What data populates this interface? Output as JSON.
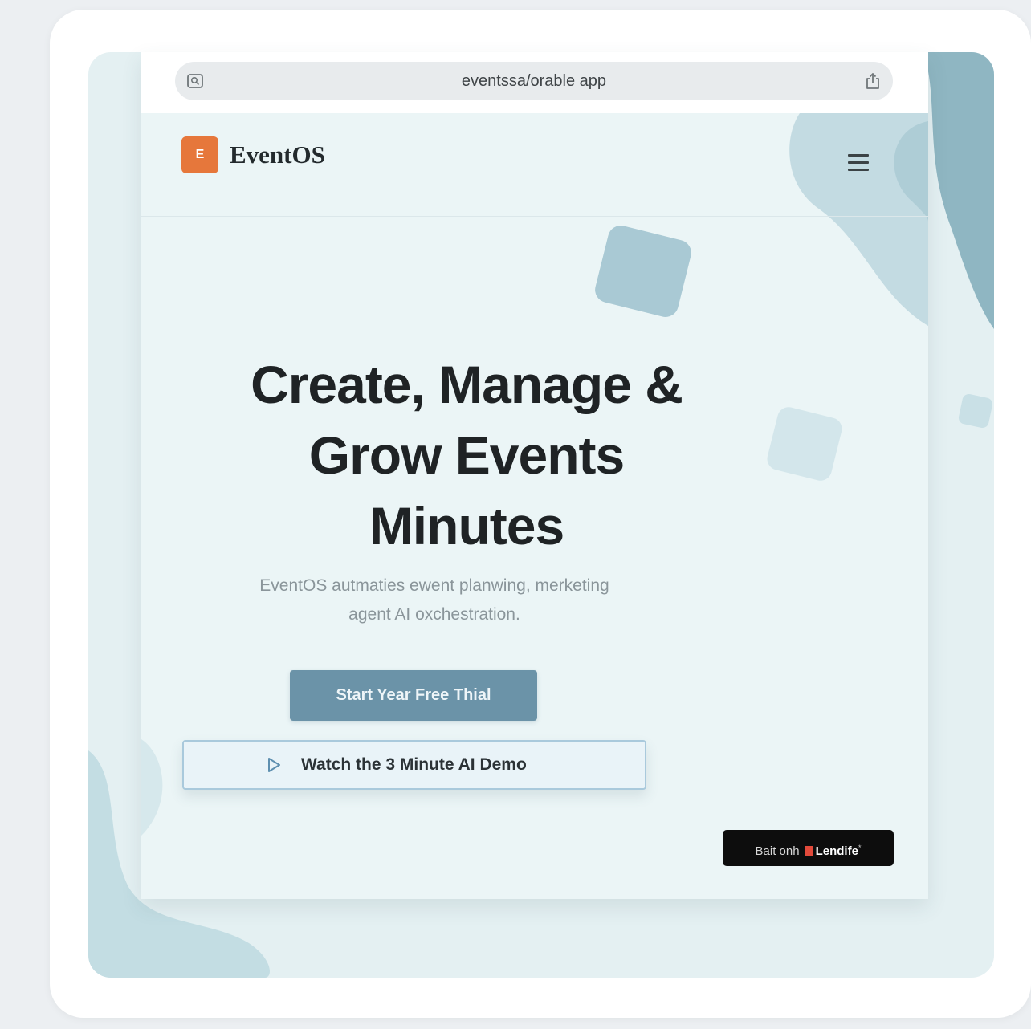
{
  "browser": {
    "url": "eventssa/orable app",
    "left_icon": "page-settings-icon",
    "right_icon": "share-icon"
  },
  "site": {
    "logo_letter": "E",
    "name": "EventOS",
    "menu_icon": "hamburger-menu-icon"
  },
  "hero": {
    "title_lines": [
      "Create, Manage &",
      "Grow Events",
      "Minutes"
    ],
    "subtitle_lines": [
      "EventOS autmaties ewent planwing, merketing",
      "agent AI oxchestration."
    ],
    "primary_cta": "Start Year Free Thial",
    "secondary_cta": "Watch the 3 Minute AI Demo",
    "secondary_icon": "play-icon"
  },
  "badge": {
    "prefix": "Bait onh",
    "brand": "Lendife",
    "suffix": "*"
  },
  "colors": {
    "accent_orange": "#e6773b",
    "primary_button": "#6b93a8",
    "background_teal": "#a9c9d4",
    "title_text": "#1f2325"
  }
}
